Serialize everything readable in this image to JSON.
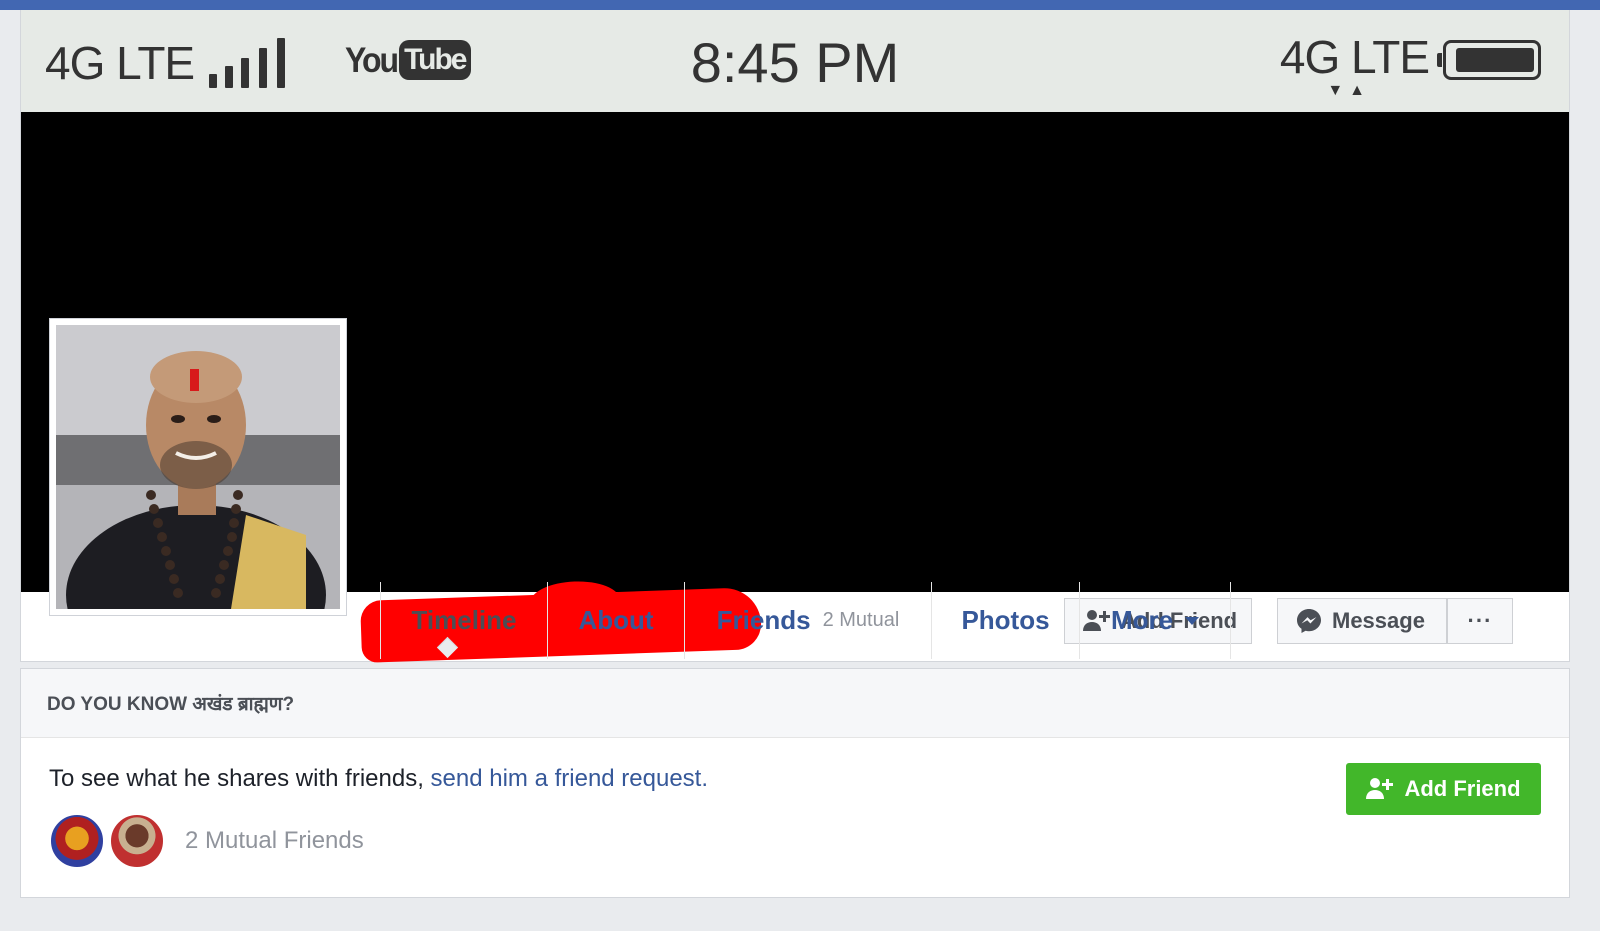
{
  "status_bar": {
    "carrier_left": "4G LTE",
    "app_badge_you": "You",
    "app_badge_tube": "Tube",
    "time": "8:45 PM",
    "carrier_right": "4G LTE",
    "data_arrows": "▼▲"
  },
  "profile": {
    "cover_color": "#000000",
    "name_redacted_color": "#ff0000",
    "buttons": {
      "add_friend": "Add Friend",
      "message": "Message",
      "more": "···"
    },
    "tabs": [
      {
        "label": "Timeline",
        "active": true
      },
      {
        "label": "About"
      },
      {
        "label": "Friends",
        "sub": "2 Mutual"
      },
      {
        "label": "Photos"
      },
      {
        "label": "More"
      }
    ]
  },
  "know_card": {
    "heading": "DO YOU KNOW अखंड ब्राह्मण?",
    "text_prefix": "To see what he shares with friends, ",
    "link_text": "send him a friend request.",
    "add_friend_button": "Add Friend",
    "mutual_friends": "2 Mutual Friends"
  },
  "colors": {
    "facebook_blue": "#4267b2",
    "link_blue": "#365899",
    "green_button": "#42b72a",
    "background": "#e9ebee"
  }
}
